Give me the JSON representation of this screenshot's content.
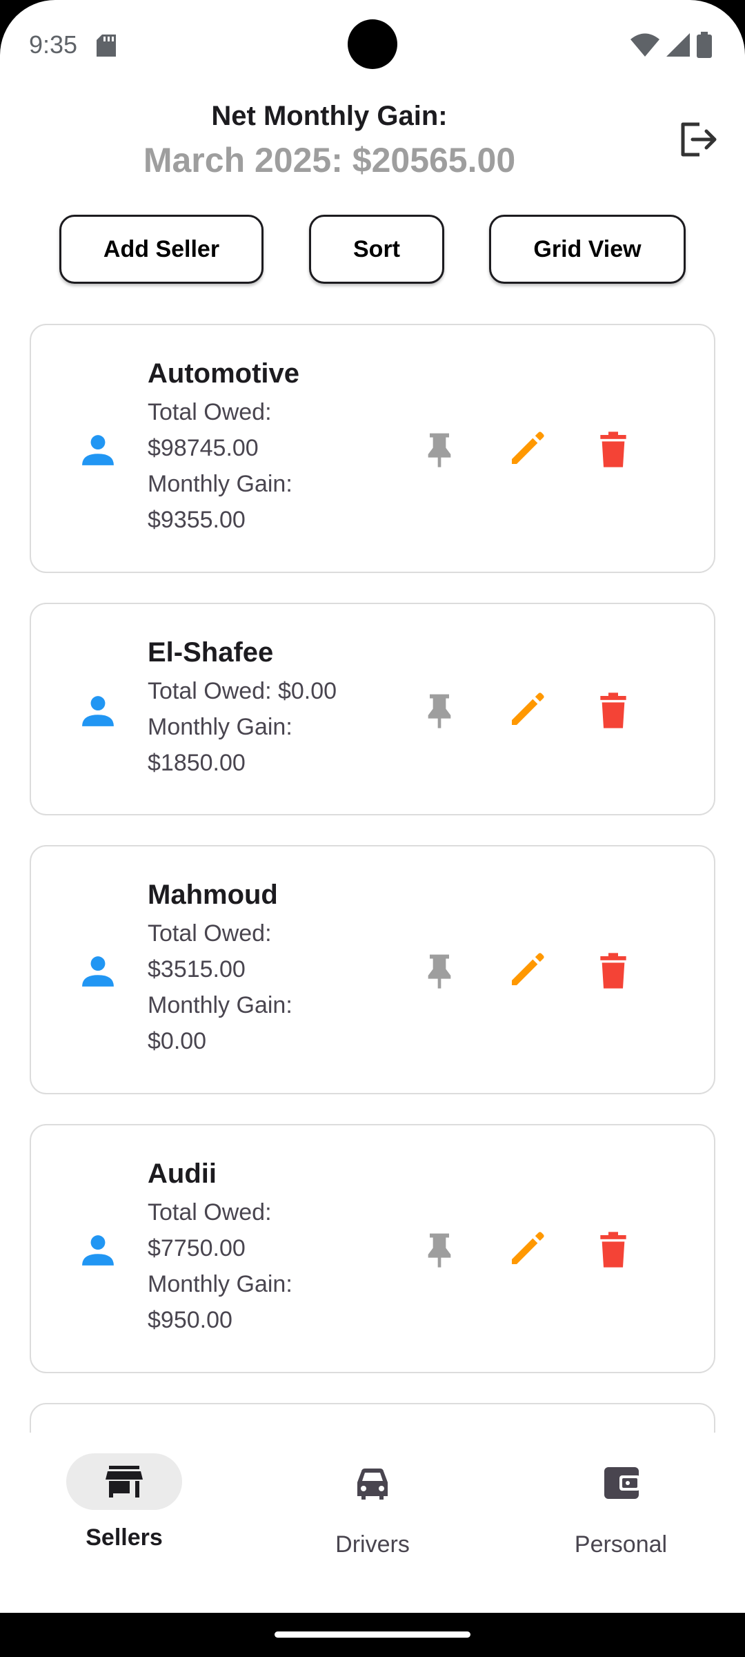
{
  "status_bar": {
    "time": "9:35"
  },
  "header": {
    "title": "Net Monthly Gain:",
    "subtitle": "March 2025: $20565.00"
  },
  "actions": {
    "add_seller": "Add Seller",
    "sort": "Sort",
    "grid_view": "Grid View"
  },
  "sellers": [
    {
      "name": "Automotive",
      "lines": [
        "Total Owed:",
        "$98745.00",
        "Monthly Gain:",
        "$9355.00"
      ]
    },
    {
      "name": "El-Shafee",
      "lines": [
        "Total Owed: $0.00",
        "Monthly Gain:",
        "$1850.00"
      ]
    },
    {
      "name": "Mahmoud",
      "lines": [
        "Total Owed:",
        "$3515.00",
        "Monthly Gain:",
        "$0.00"
      ]
    },
    {
      "name": "Audii",
      "lines": [
        "Total Owed:",
        "$7750.00",
        "Monthly Gain:",
        "$950.00"
      ]
    }
  ],
  "nav": {
    "sellers": "Sellers",
    "drivers": "Drivers",
    "personal": "Personal",
    "active": "sellers"
  },
  "colors": {
    "person_icon": "#2196f3",
    "pin_icon": "#9e9e9e",
    "edit_icon": "#ff9800",
    "delete_icon": "#f44336"
  }
}
